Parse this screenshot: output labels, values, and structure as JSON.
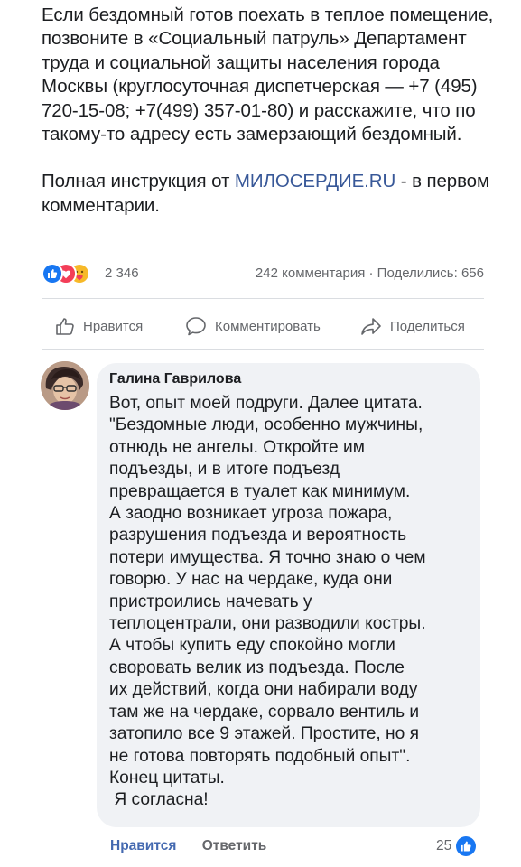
{
  "post": {
    "paragraph1": "Если бездомный готов поехать в теплое помещение, позвоните в «Социальный патруль» Департамент труда и социальной защиты населения города Москвы (круглосуточная диспетчерская — +7 (495) 720-15-08; +7(499) 357-01-80) и расскажите, что по такому-то адресу есть замерзающий бездомный.",
    "paragraph2_before": "Полная инструкция от ",
    "paragraph2_link": "МИЛОСЕРДИЕ.RU",
    "paragraph2_after": " - в первом комментарии."
  },
  "stats": {
    "reaction_count": "2 346",
    "comments_shares": "242 комментария · Поделились: 656",
    "reaction_icons": [
      "like-icon",
      "love-icon",
      "care-icon"
    ]
  },
  "actions": {
    "like": "Нравится",
    "comment": "Комментировать",
    "share": "Поделиться"
  },
  "comment": {
    "author": "Галина Гаврилова",
    "lines": [
      "Вот, опыт моей подруги. Далее цитата.",
      "\"Бездомные люди, особенно мужчины,",
      "отнюдь не ангелы.  Откройте им",
      "подъезды, и в итоге подъезд",
      "превращается в туалет как минимум.",
      "А заодно возникает угроза пожара,",
      "разрушения подъезда и вероятность",
      "потери имущества. Я точно знаю о чем",
      "говорю.  У нас на чердаке, куда они",
      "пристроились начевать у",
      "теплоцентрали, они разводили костры.",
      "А чтобы купить еду спокойно могли",
      "своровать велик из подъезда. После",
      "их действий,  когда они набирали воду",
      "там же на чердаке, сорвало вентиль и",
      "затопило все 9 этажей.  Простите, но я",
      "не готова повторять подобный опыт\".",
      "Конец цитаты.",
      " Я согласна!"
    ],
    "like_label": "Нравится",
    "reply_label": "Ответить",
    "reaction_count": "25"
  },
  "colors": {
    "like_blue": "#1877f2",
    "love_red": "#f33e58",
    "care_yellow": "#f7b928",
    "link": "#385898"
  }
}
